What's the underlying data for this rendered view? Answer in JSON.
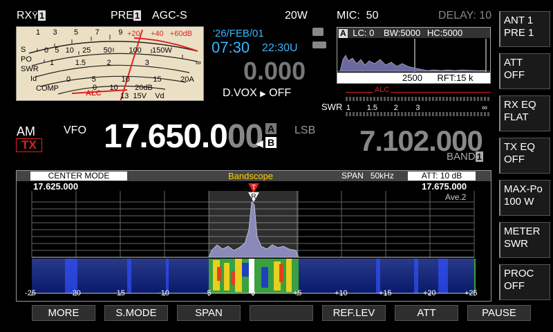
{
  "top": {
    "rx_label": "RX",
    "rx_num": "1",
    "pre_label": "PRE",
    "pre_num": "1",
    "agc": "AGC-S",
    "power": "20W",
    "mic_label": "MIC:",
    "mic_value": "50",
    "delay": "DELAY: 10"
  },
  "meter": {
    "scale_s": [
      "1",
      "3",
      "5",
      "7",
      "9",
      "+20",
      "+40",
      "+60dB"
    ],
    "scale_po": [
      "0",
      "5",
      "10",
      "25",
      "50",
      "100",
      "150W"
    ],
    "scale_swr": [
      "1",
      "1.5",
      "2",
      "3",
      "∞"
    ],
    "scale_id": [
      "0",
      "5",
      "10",
      "15",
      "20A"
    ],
    "scale_comp": [
      "0",
      "10",
      "20dB"
    ],
    "row_labels": [
      "S",
      "PO",
      "SWR",
      "Id",
      "COMP"
    ],
    "alc_label": "ALC",
    "vd_label": "Vd",
    "vd_scale": [
      "13",
      "15V"
    ]
  },
  "clock": {
    "date": "'26/FEB/01",
    "time": "07:30",
    "utc": "22:30U",
    "rit": "0.000"
  },
  "dvox": {
    "label": "D.VOX",
    "value": "OFF"
  },
  "mini_scope": {
    "mode": "A",
    "lc": "LC:   0",
    "bw": "BW:5000",
    "hc": "HC:5000",
    "freq": "2500",
    "rft": "RFT:15 k"
  },
  "alc_bar": {
    "label": "ALC",
    "swr_label": "SWR",
    "swr_scale": [
      "1",
      "1.5",
      "2",
      "3",
      "∞"
    ]
  },
  "vfo": {
    "mode": "AM",
    "tx": "TX",
    "vfo_label": "VFO",
    "freq_main": "17.650.0",
    "freq_dim": "00",
    "vfo_a": "A",
    "vfo_b": "B",
    "sideband": "LSB",
    "sub_freq": "7.102.000",
    "band_label": "BAND",
    "band_num": "1"
  },
  "bandscope": {
    "mode": "CENTER MODE",
    "title": "Bandscope",
    "span_label": "SPAN",
    "span_value": "50kHz",
    "att": "ATT: 10 dB",
    "freq_left": "17.625.000",
    "freq_right": "17.675.000",
    "average": "Ave.2",
    "marker_t": "T",
    "marker_r": "R",
    "x_ticks": [
      "-25",
      "-20",
      "-15",
      "-10",
      "-5",
      "0",
      "+5",
      "+10",
      "+15",
      "+20",
      "+25"
    ]
  },
  "right_buttons": [
    {
      "l1": "ANT 1",
      "l2": "PRE 1"
    },
    {
      "l1": "ATT",
      "l2": "OFF"
    },
    {
      "l1": "RX EQ",
      "l2": "FLAT"
    },
    {
      "l1": "TX EQ",
      "l2": "OFF"
    },
    {
      "l1": "MAX-Po",
      "l2": "100 W"
    },
    {
      "l1": "METER",
      "l2": "SWR"
    },
    {
      "l1": "PROC",
      "l2": "OFF"
    }
  ],
  "bottom_buttons": [
    "MORE",
    "S.MODE",
    "SPAN",
    "",
    "REF.LEV",
    "ATT",
    "PAUSE"
  ],
  "colors": {
    "accent_blue": "#38b8ff",
    "tx_red": "#e02020",
    "meter_bg": "#ece0c4",
    "alc_red": "#e02020"
  },
  "icons": {
    "antenna": "antenna-icon",
    "sd_card": "sd-card-icon",
    "usb": "usb-icon"
  }
}
